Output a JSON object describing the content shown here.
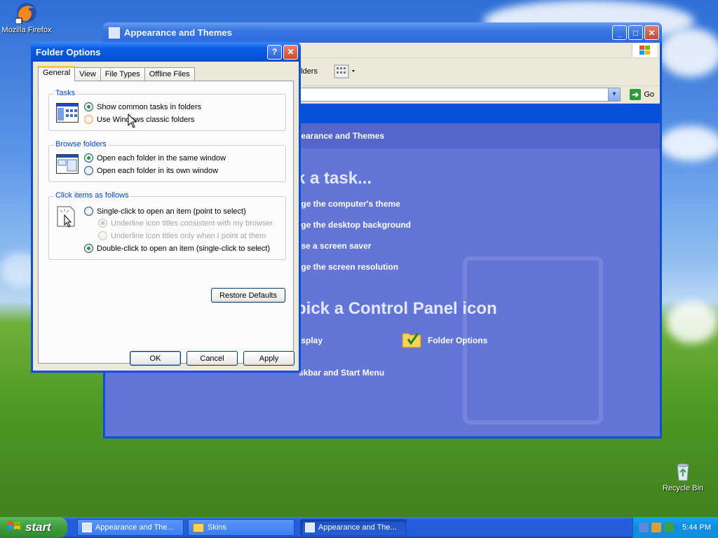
{
  "desktop": {
    "icons": [
      {
        "label": "Mozilla Firefox"
      },
      {
        "label": "Recycle Bin"
      }
    ]
  },
  "control_panel": {
    "title": "Appearance and Themes",
    "toolbar": {
      "folders_label": "olders"
    },
    "address": {
      "go_label": "Go"
    },
    "header": "pearance and Themes",
    "pick_task": "k a task...",
    "tasks": [
      "nge the computer's theme",
      "nge the desktop background",
      "ose a screen saver",
      "nge the screen resolution"
    ],
    "pick_icon": "pick a Control Panel icon",
    "icons": [
      {
        "label": "isplay"
      },
      {
        "label": "Folder Options"
      },
      {
        "label": "skbar and Start Menu"
      }
    ]
  },
  "dialog": {
    "title": "Folder Options",
    "help_glyph": "?",
    "close_glyph": "✕",
    "tabs": [
      "General",
      "View",
      "File Types",
      "Offline Files"
    ],
    "active_tab": "General",
    "tasks_group": {
      "title": "Tasks",
      "options": [
        {
          "label": "Show common tasks in folders",
          "selected": true
        },
        {
          "label": "Use Windows classic folders",
          "selected": false
        }
      ]
    },
    "browse_group": {
      "title": "Browse folders",
      "options": [
        {
          "label": "Open each folder in the same window",
          "selected": true
        },
        {
          "label": "Open each folder in its own window",
          "selected": false
        }
      ]
    },
    "click_group": {
      "title": "Click items as follows",
      "options": [
        {
          "label": "Single-click to open an item (point to select)",
          "selected": false
        },
        {
          "label": "Underline icon titles consistent with my browser",
          "selected": true,
          "disabled": true
        },
        {
          "label": "Underline icon titles only when I point at them",
          "selected": false,
          "disabled": true
        },
        {
          "label": "Double-click to open an item (single-click to select)",
          "selected": true
        }
      ]
    },
    "restore_defaults": "Restore Defaults",
    "ok": "OK",
    "cancel": "Cancel",
    "apply": "Apply"
  },
  "taskbar": {
    "start": "start",
    "tasks": [
      {
        "label": "Appearance and The...",
        "active": false
      },
      {
        "label": "Skins",
        "active": false
      },
      {
        "label": "Appearance and The...",
        "active": true
      }
    ],
    "clock": "5:44 PM"
  },
  "colors": {
    "xp_blue": "#0a50d8",
    "cp_task_pane": "#6375d6",
    "tab_highlight": "#ffc83c",
    "group_title": "#0046d5"
  }
}
